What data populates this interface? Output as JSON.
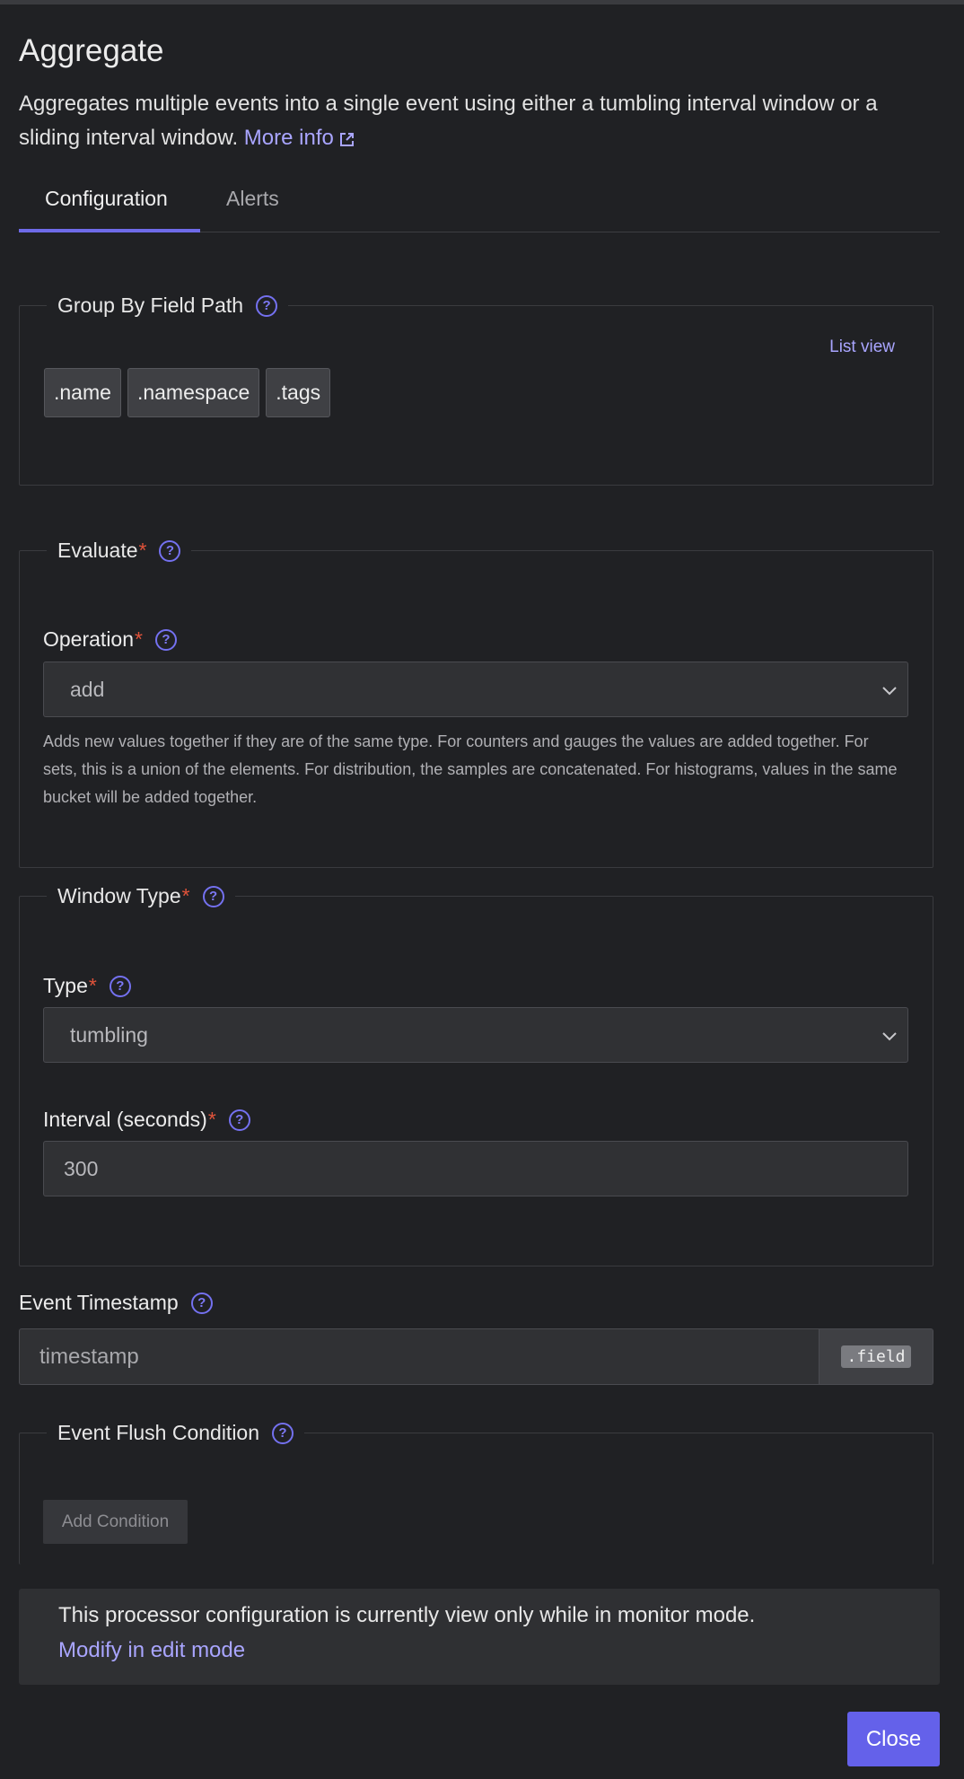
{
  "header": {
    "title": "Aggregate",
    "description": "Aggregates multiple events into a single event using either a tumbling interval window or a sliding interval window.",
    "more_info": "More info"
  },
  "tabs": [
    {
      "label": "Configuration",
      "active": true
    },
    {
      "label": "Alerts",
      "active": false
    }
  ],
  "group_by": {
    "legend": "Group By Field Path",
    "list_view": "List view",
    "chips": [
      ".name",
      ".namespace",
      ".tags"
    ]
  },
  "evaluate": {
    "legend": "Evaluate",
    "operation_label": "Operation",
    "operation_value": "add",
    "operation_hint": "Adds new values together if they are of the same type. For counters and gauges the values are added together. For sets, this is a union of the elements. For distribution, the samples are concatenated. For histograms, values in the same bucket will be added together."
  },
  "window_type": {
    "legend": "Window Type",
    "type_label": "Type",
    "type_value": "tumbling",
    "interval_label": "Interval (seconds)",
    "interval_value": "300"
  },
  "event_timestamp": {
    "label": "Event Timestamp",
    "placeholder": "timestamp",
    "addon": ".field"
  },
  "flush_condition": {
    "legend": "Event Flush Condition",
    "add_button": "Add Condition"
  },
  "notice": {
    "text": "This processor configuration is currently view only while in monitor mode.",
    "link": "Modify in edit mode"
  },
  "footer": {
    "close_label": "Close"
  },
  "colors": {
    "background": "#202124",
    "accent": "#6461ea",
    "link": "#a9a5ff",
    "required": "#e0533a"
  }
}
